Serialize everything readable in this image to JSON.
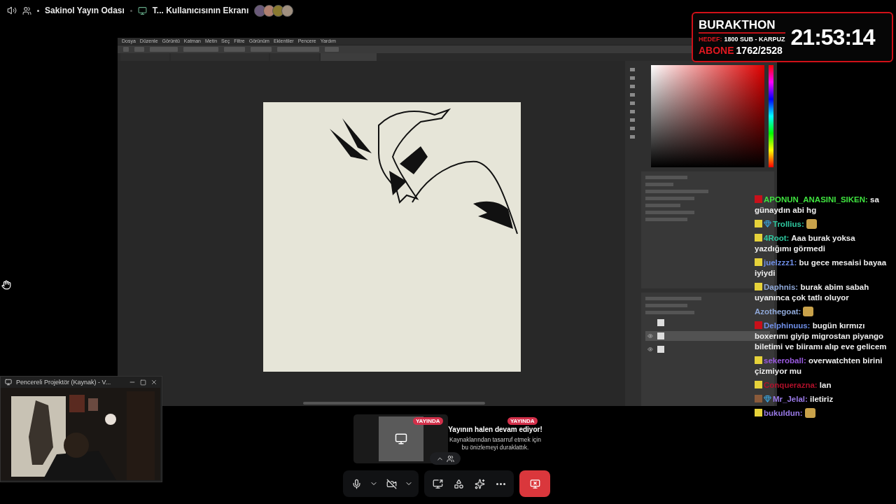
{
  "header": {
    "channel": "Sakinol Yayın Odası",
    "screen": "T... Kullanıcısının Ekranı"
  },
  "photoshop": {
    "menu": [
      "Dosya",
      "Düzenle",
      "Görüntü",
      "Katman",
      "Metin",
      "Seç",
      "Filtre",
      "Görünüm",
      "Eklentiler",
      "Pencere",
      "Yardım"
    ],
    "tabs": [
      {
        "selected": false
      },
      {
        "selected": false
      },
      {
        "selected": false
      },
      {
        "selected": true
      }
    ],
    "layers": [
      {
        "visible": false,
        "selected": false
      },
      {
        "visible": true,
        "selected": true
      },
      {
        "visible": true,
        "selected": false
      }
    ]
  },
  "overlay": {
    "title": "BURAKTHON",
    "goal_label": "HEDEF:",
    "goal": "1800 SUB - KARPUZ",
    "subs_label": "ABONE",
    "subs": "1762/2528",
    "timer": "21:53:14"
  },
  "chat": [
    {
      "badges": [
        {
          "kind": "vip"
        }
      ],
      "user": "APONUN_ANASINI_SIKEN:",
      "color": "#3fe23f",
      "text": "sa günaydın abi hg"
    },
    {
      "badges": [
        {
          "kind": "sub"
        },
        {
          "kind": "gem"
        }
      ],
      "user": "Trollius:",
      "color": "#2fc9a0",
      "emote": true
    },
    {
      "badges": [
        {
          "kind": "sub"
        }
      ],
      "user": "4Root:",
      "color": "#2fc9a0",
      "text": "Aaa burak yoksa yazdığımı görmedi"
    },
    {
      "badges": [
        {
          "kind": "sub"
        }
      ],
      "user": "juelzzz1:",
      "color": "#6f8fe8",
      "text": "bu gece mesaisi bayaa iyiydi"
    },
    {
      "badges": [
        {
          "kind": "sub"
        }
      ],
      "user": "Daphnis:",
      "color": "#8fa8d8",
      "text": "burak abim sabah uyanınca çok tatlı oluyor"
    },
    {
      "user": "Azothegoat:",
      "color": "#8fa8d8",
      "emote": true
    },
    {
      "badges": [
        {
          "kind": "vip"
        }
      ],
      "user": "Delphinuus:",
      "color": "#6f8fe8",
      "text": "bugün kırmızı boxerımı giyip migrostan piyango biletimi ve biiramı alıp eve gelicem"
    },
    {
      "badges": [
        {
          "kind": "sub"
        }
      ],
      "user": "sekeroball:",
      "color": "#9a5ae0",
      "text": "overwatchten birini çizmiyor mu"
    },
    {
      "badges": [
        {
          "kind": "sub"
        }
      ],
      "user": "Conquerazna:",
      "color": "#b0102a",
      "text": "lan"
    },
    {
      "badges": [
        {
          "kind": "bronze"
        },
        {
          "kind": "gem"
        }
      ],
      "user": "Mr_Jelal:",
      "color": "#9a7ae8",
      "text": "iletiriz"
    },
    {
      "badges": [
        {
          "kind": "sub"
        }
      ],
      "user": "bukuldun:",
      "color": "#9a7ae8",
      "emote": true
    }
  ],
  "webcam": {
    "title": "Pencereli Projektör (Kaynak) - V..."
  },
  "preview": {
    "badges": [
      "YAYINDA",
      "YAYINDA"
    ],
    "title": "Yayının halen devam ediyor!",
    "body": "Kaynaklarından tasarruf etmek için bu önizlemeyi duraklattık."
  },
  "control_groups": [
    [
      {
        "kind": "mic",
        "muted": false
      },
      {
        "kind": "caret"
      },
      {
        "kind": "camera",
        "on": false
      },
      {
        "kind": "caret"
      }
    ],
    [
      {
        "kind": "share"
      },
      {
        "kind": "activities"
      },
      {
        "kind": "soundboard"
      },
      {
        "kind": "more"
      }
    ]
  ],
  "end_button": {
    "kind": "stop_stream"
  }
}
